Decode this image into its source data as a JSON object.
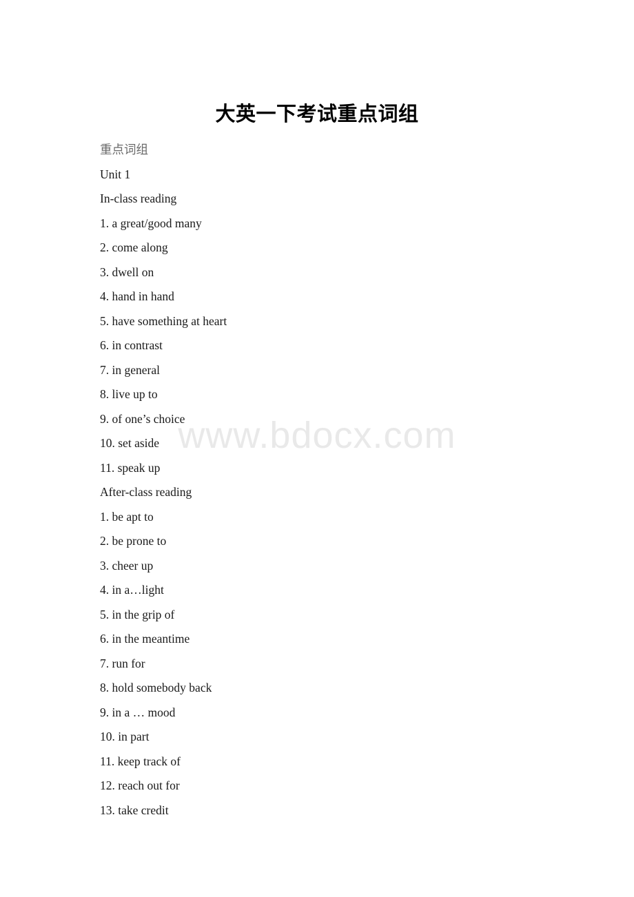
{
  "document": {
    "title": "大英一下考试重点词组",
    "watermark": "www.bdocx.com",
    "lines": [
      {
        "text": "重点词组",
        "style": "muted"
      },
      {
        "text": "Unit 1",
        "style": "normal"
      },
      {
        "text": "In-class reading",
        "style": "normal"
      },
      {
        "text": "1. a great/good many",
        "style": "normal"
      },
      {
        "text": "2. come along",
        "style": "normal"
      },
      {
        "text": "3. dwell on",
        "style": "normal"
      },
      {
        "text": "4. hand in hand",
        "style": "normal"
      },
      {
        "text": "5. have something at heart",
        "style": "normal"
      },
      {
        "text": "6. in contrast",
        "style": "normal"
      },
      {
        "text": "7. in general",
        "style": "normal"
      },
      {
        "text": "8. live up to",
        "style": "normal"
      },
      {
        "text": "9. of one’s choice",
        "style": "normal"
      },
      {
        "text": "10. set aside",
        "style": "normal"
      },
      {
        "text": "11. speak up",
        "style": "normal"
      },
      {
        "text": "After-class reading",
        "style": "normal"
      },
      {
        "text": "1. be apt to",
        "style": "normal"
      },
      {
        "text": "2. be prone to",
        "style": "normal"
      },
      {
        "text": "3. cheer up",
        "style": "normal"
      },
      {
        "text": "4. in a…light",
        "style": "normal"
      },
      {
        "text": "5. in the grip of",
        "style": "normal"
      },
      {
        "text": "6. in the meantime",
        "style": "normal"
      },
      {
        "text": "7. run for",
        "style": "normal"
      },
      {
        "text": "8. hold somebody back",
        "style": "normal"
      },
      {
        "text": "9. in a … mood",
        "style": "normal"
      },
      {
        "text": "10. in part",
        "style": "normal"
      },
      {
        "text": "11. keep track of",
        "style": "normal"
      },
      {
        "text": "12. reach out for",
        "style": "normal"
      },
      {
        "text": "13. take credit",
        "style": "normal"
      }
    ]
  },
  "colors": {
    "page_background": "#ffffff",
    "body_text": "#1a1a1a",
    "muted_text": "#6a6a6a",
    "watermark": "#e9e9e9"
  }
}
